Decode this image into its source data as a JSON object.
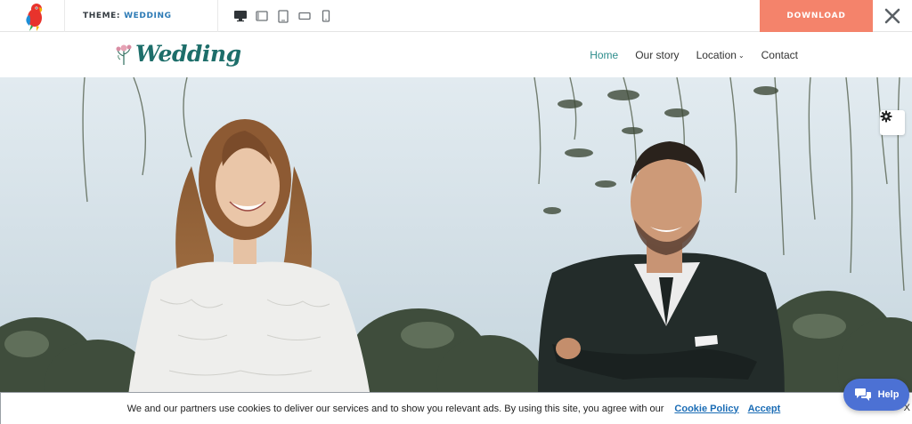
{
  "toolbar": {
    "theme_label": "THEME:",
    "theme_name": "WEDDING",
    "devices": [
      "desktop-icon",
      "laptop-icon",
      "tablet-portrait-icon",
      "tablet-landscape-icon",
      "mobile-icon"
    ],
    "download_label": "DOWNLOAD",
    "colors": {
      "download_bg": "#f4836b",
      "theme_name": "#2c7ab5"
    }
  },
  "site": {
    "brand": "Wedding",
    "nav": [
      {
        "label": "Home",
        "active": true
      },
      {
        "label": "Our story",
        "active": false
      },
      {
        "label": "Location",
        "active": false
      },
      {
        "label": "Contact",
        "active": false
      }
    ],
    "colors": {
      "brand": "#1d6e6a",
      "nav_active": "#2e8d8c"
    }
  },
  "hero": {
    "image": "wedding-couple-photo",
    "settings_icon": "gear-icon"
  },
  "cookie": {
    "text": "We and our partners use cookies to deliver our services and to show you relevant ads. By using this site, you agree with our",
    "policy_link": "Cookie Policy",
    "accept_link": "Accept",
    "close": "X"
  },
  "help": {
    "label": "Help",
    "color": "#4c71d4"
  }
}
